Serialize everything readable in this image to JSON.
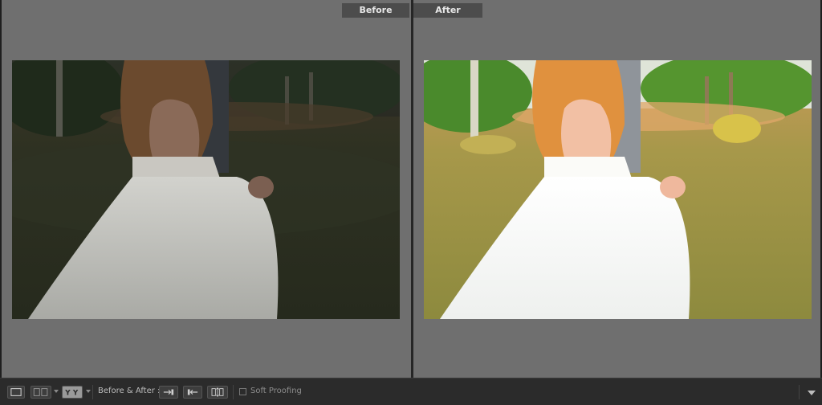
{
  "panes": {
    "before_label": "Before",
    "after_label": "After"
  },
  "toolbar": {
    "before_after_label": "Before & After :",
    "soft_proofing_label": "Soft Proofing",
    "icons": [
      "loupe-view-icon",
      "side-by-side-view-icon",
      "split-view-icon",
      "swap-settings-icon",
      "copy-before-to-after-icon",
      "swap-before-after-icon",
      "toolbar-menu-icon"
    ]
  },
  "colors": {
    "panel_bg": "#6f6f6f",
    "toolbar_bg": "#2b2b2b",
    "label_bg": "#4c4c4c"
  }
}
